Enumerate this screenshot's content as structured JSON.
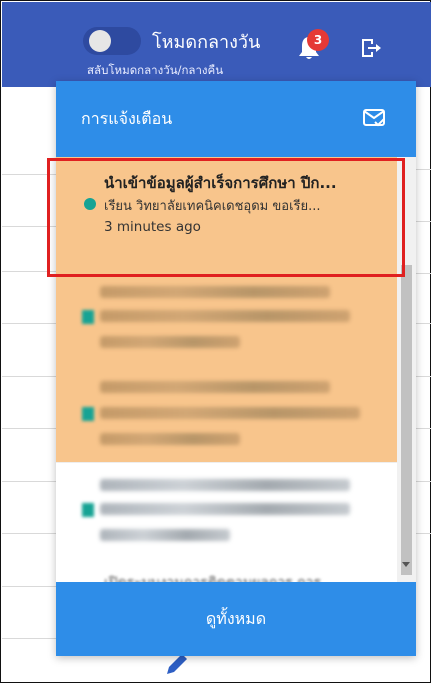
{
  "topbar": {
    "mode_label": "โหมดกลางวัน",
    "mode_sub": "สลับโหมดกลางวัน/กลางคืน",
    "notification_count": "3"
  },
  "notifications": {
    "title": "การแจ้งเตือน",
    "items": [
      {
        "title": "นำเข้าข้อมูลผู้สำเร็จการศึกษา ปีก...",
        "body": "เรียน วิทยาลัยเทคนิคเดชอุดม ขอเรีย...",
        "time": "3 minutes ago",
        "unread": true
      }
    ],
    "partial_item": "เปิดระบบงานการติดตามผลการ การ",
    "view_all": "ดูทั้งหมด"
  },
  "colors": {
    "topbar": "#3a5bb9",
    "accent": "#2e8de8",
    "unread_bg": "#f8c58c",
    "dot": "#16a394",
    "badge": "#e53935",
    "highlight": "#e02020"
  }
}
